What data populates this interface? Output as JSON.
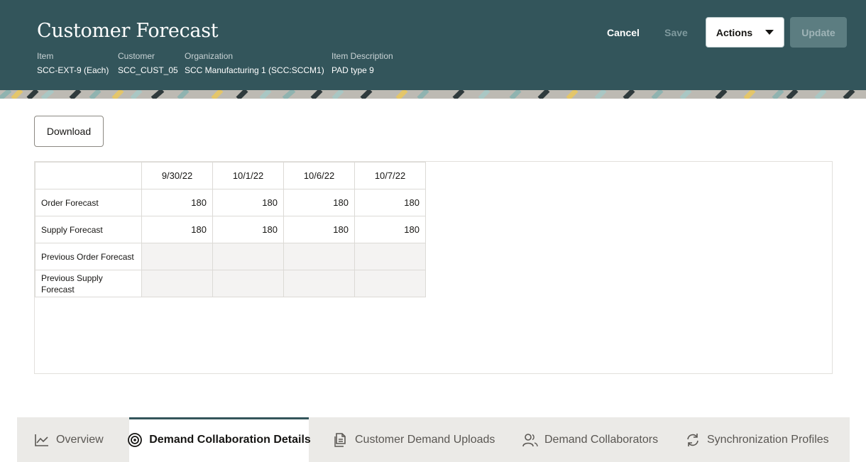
{
  "header": {
    "title": "Customer Forecast",
    "fields": [
      {
        "label": "Item",
        "value": "SCC-EXT-9 (Each)"
      },
      {
        "label": "Customer",
        "value": "SCC_CUST_05"
      },
      {
        "label": "Organization",
        "value": "SCC Manufacturing 1 (SCC:SCCM1)"
      },
      {
        "label": "Item Description",
        "value": "PAD type 9"
      }
    ],
    "cancel_label": "Cancel",
    "save_label": "Save",
    "actions_label": "Actions",
    "update_label": "Update"
  },
  "toolbar": {
    "download_label": "Download"
  },
  "grid": {
    "columns": [
      "9/30/22",
      "10/1/22",
      "10/6/22",
      "10/7/22"
    ],
    "rows": [
      {
        "label": "Order Forecast",
        "values": [
          "180",
          "180",
          "180",
          "180"
        ]
      },
      {
        "label": "Supply Forecast",
        "values": [
          "180",
          "180",
          "180",
          "180"
        ]
      },
      {
        "label": "Previous Order Forecast",
        "values": [
          "",
          "",
          "",
          ""
        ]
      },
      {
        "label": "Previous Supply Forecast",
        "values": [
          "",
          "",
          "",
          ""
        ]
      }
    ]
  },
  "tabs": [
    {
      "label": "Overview",
      "icon": "chart-line-icon",
      "active": false
    },
    {
      "label": "Demand Collaboration Details",
      "icon": "target-icon",
      "active": true
    },
    {
      "label": "Customer Demand Uploads",
      "icon": "document-upload-icon",
      "active": false
    },
    {
      "label": "Demand Collaborators",
      "icon": "users-icon",
      "active": false
    },
    {
      "label": "Synchronization Profiles",
      "icon": "sync-icon",
      "active": false
    }
  ],
  "colors": {
    "header_bg": "#33555b",
    "active_tab_accent": "#33555b",
    "tabbar_bg": "#ebeae7"
  }
}
